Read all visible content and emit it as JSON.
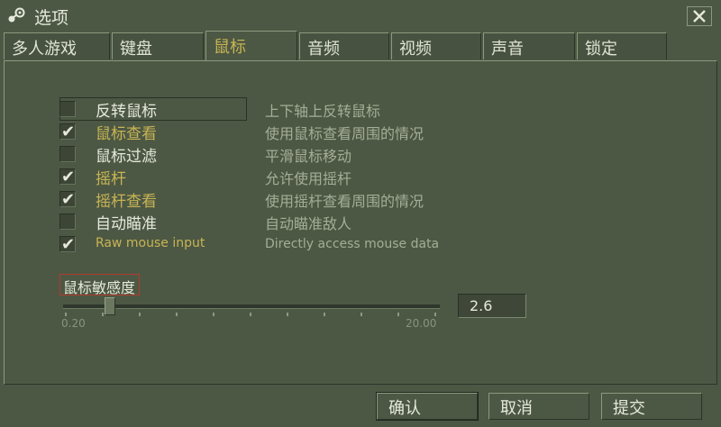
{
  "window": {
    "title": "选项",
    "icon": "steam-logo-icon",
    "close_icon": "close-icon"
  },
  "tabs": [
    {
      "label": "多人游戏",
      "active": false
    },
    {
      "label": "键盘",
      "active": false
    },
    {
      "label": "鼠标",
      "active": true
    },
    {
      "label": "音频",
      "active": false
    },
    {
      "label": "视频",
      "active": false
    },
    {
      "label": "声音",
      "active": false
    },
    {
      "label": "锁定",
      "active": false
    }
  ],
  "options": [
    {
      "label": "反转鼠标",
      "checked": false,
      "description": "上下轴上反转鼠标"
    },
    {
      "label": "鼠标查看",
      "checked": true,
      "description": "使用鼠标查看周围的情况"
    },
    {
      "label": "鼠标过滤",
      "checked": false,
      "description": "平滑鼠标移动"
    },
    {
      "label": "摇杆",
      "checked": true,
      "description": "允许使用摇杆"
    },
    {
      "label": "摇杆查看",
      "checked": true,
      "description": "使用摇杆查看周围的情况"
    },
    {
      "label": "自动瞄准",
      "checked": false,
      "description": "自动瞄准敌人"
    },
    {
      "label": "Raw mouse input",
      "checked": true,
      "description": "Directly access mouse data"
    }
  ],
  "sensitivity": {
    "label": "鼠标敏感度",
    "min_label": "0.20",
    "max_label": "20.00",
    "value": "2.6",
    "min": 0.2,
    "max": 20.0
  },
  "buttons": {
    "ok": "确认",
    "cancel": "取消",
    "apply": "提交"
  },
  "colors": {
    "background": "#4c5844",
    "accent": "#c8b454",
    "text": "#e6e9da",
    "muted": "#a5ad96",
    "focus_border": "#b03a2e"
  }
}
